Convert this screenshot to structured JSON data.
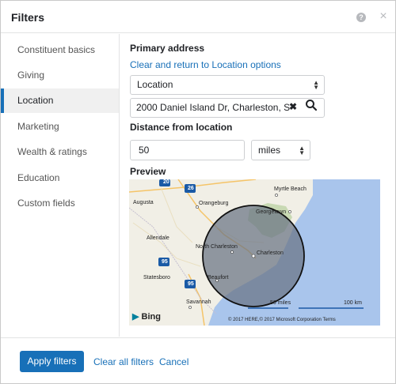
{
  "header": {
    "title": "Filters",
    "help_glyph": "?",
    "close_glyph": "×"
  },
  "sidebar": {
    "items": [
      {
        "label": "Constituent basics",
        "active": false
      },
      {
        "label": "Giving",
        "active": false
      },
      {
        "label": "Location",
        "active": true
      },
      {
        "label": "Marketing",
        "active": false
      },
      {
        "label": "Wealth & ratings",
        "active": false
      },
      {
        "label": "Education",
        "active": false
      },
      {
        "label": "Custom fields",
        "active": false
      }
    ]
  },
  "main": {
    "primary_address_label": "Primary address",
    "clear_return_link": "Clear and return to Location options",
    "location_select_value": "Location",
    "address_value": "2000 Daniel Island Dr, Charleston, S",
    "clear_glyph": "✖",
    "distance_label": "Distance from location",
    "distance_value": "50",
    "unit_select_value": "miles",
    "preview_label": "Preview"
  },
  "map": {
    "labels": {
      "myrtle_beach": "Myrtle Beach",
      "augusta": "Augusta",
      "orangeburg": "Orangeburg",
      "georgetown": "Georgetown",
      "allendale": "Allendale",
      "north_charleston": "North Charleston",
      "charleston": "Charleston",
      "statesboro": "Statesboro",
      "beaufort": "Beaufort",
      "savannah": "Savannah"
    },
    "highway_shields": [
      "20",
      "26",
      "95",
      "95"
    ],
    "scale_miles": "50 miles",
    "scale_km": "100 km",
    "brand": "Bing",
    "copyright": "© 2017 HERE,© 2017 Microsoft Corporation",
    "terms": "Terms"
  },
  "footer": {
    "apply_label": "Apply filters",
    "clear_all_label": "Clear all filters",
    "cancel_label": "Cancel"
  },
  "colors": {
    "accent": "#1870b8",
    "water": "#a9c5ec",
    "land": "#f1efe6",
    "radius_fill": "#6a7384"
  },
  "icons": [
    "help-icon",
    "close-icon",
    "chevron-updown-icon",
    "search-icon",
    "clear-icon",
    "bing-logo-icon"
  ]
}
